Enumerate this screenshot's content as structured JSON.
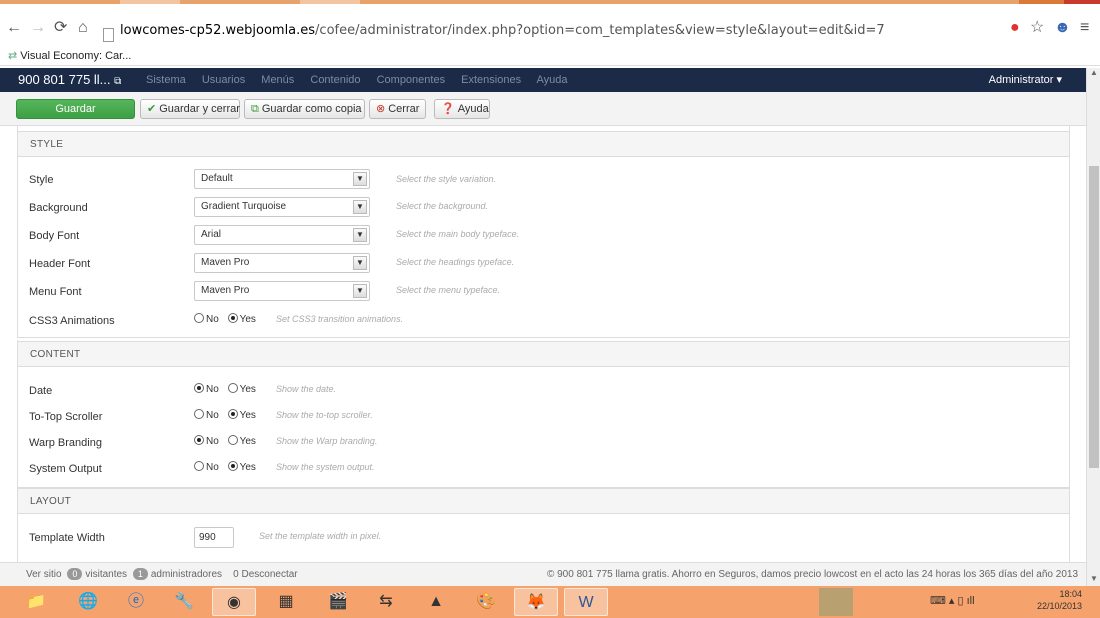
{
  "browser": {
    "url_domain": "lowcomes-cp52.webjoomla.es",
    "url_path": "/cofee/administrator/index.php?option=com_templates&view=style&layout=edit&id=7",
    "bookmark": "Visual Economy: Car..."
  },
  "navbar": {
    "site": "900 801 775 ll...",
    "menu": [
      "Sistema",
      "Usuarios",
      "Menús",
      "Contenido",
      "Componentes",
      "Extensiones",
      "Ayuda"
    ],
    "user": "Administrator"
  },
  "toolbar": {
    "save": "Guardar",
    "save_close": "Guardar y cerrar",
    "save_copy": "Guardar como copia",
    "close": "Cerrar",
    "help": "Ayuda"
  },
  "style_section": {
    "title": "STYLE",
    "rows": [
      {
        "label": "Style",
        "value": "Default",
        "hint": "Select the style variation."
      },
      {
        "label": "Background",
        "value": "Gradient Turquoise",
        "hint": "Select the background."
      },
      {
        "label": "Body Font",
        "value": "Arial",
        "hint": "Select the main body typeface."
      },
      {
        "label": "Header Font",
        "value": "Maven Pro",
        "hint": "Select the headings typeface."
      },
      {
        "label": "Menu Font",
        "value": "Maven Pro",
        "hint": "Select the menu typeface."
      }
    ],
    "css3": {
      "label": "CSS3 Animations",
      "no": "No",
      "yes": "Yes",
      "hint": "Set CSS3 transition animations."
    }
  },
  "content_section": {
    "title": "CONTENT",
    "rows": [
      {
        "label": "Date",
        "no": "No",
        "yes": "Yes",
        "selected": "No",
        "hint": "Show the date."
      },
      {
        "label": "To-Top Scroller",
        "no": "No",
        "yes": "Yes",
        "selected": "Yes",
        "hint": "Show the to-top scroller."
      },
      {
        "label": "Warp Branding",
        "no": "No",
        "yes": "Yes",
        "selected": "No",
        "hint": "Show the Warp branding."
      },
      {
        "label": "System Output",
        "no": "No",
        "yes": "Yes",
        "selected": "Yes",
        "hint": "Show the system output."
      }
    ]
  },
  "layout_section": {
    "title": "LAYOUT",
    "template_width": {
      "label": "Template Width",
      "value": "990",
      "hint": "Set the template width in pixel."
    }
  },
  "footer": {
    "view_site": "Ver sitio",
    "visitors_count": "0",
    "visitors": "visitantes",
    "admins_count": "1",
    "admins": "administradores",
    "logout": "0 Desconectar",
    "copyright": "© 900 801 775 llama gratis. Ahorro en Seguros, damos precio lowcost en el acto las 24 horas los 365 días del año 2013"
  },
  "taskbar": {
    "time": "18:04",
    "date": "22/10/2013"
  },
  "colors": {
    "navbar": "#1a2a47",
    "save_green": "#46a74b",
    "taskbar": "#f5a26c"
  }
}
